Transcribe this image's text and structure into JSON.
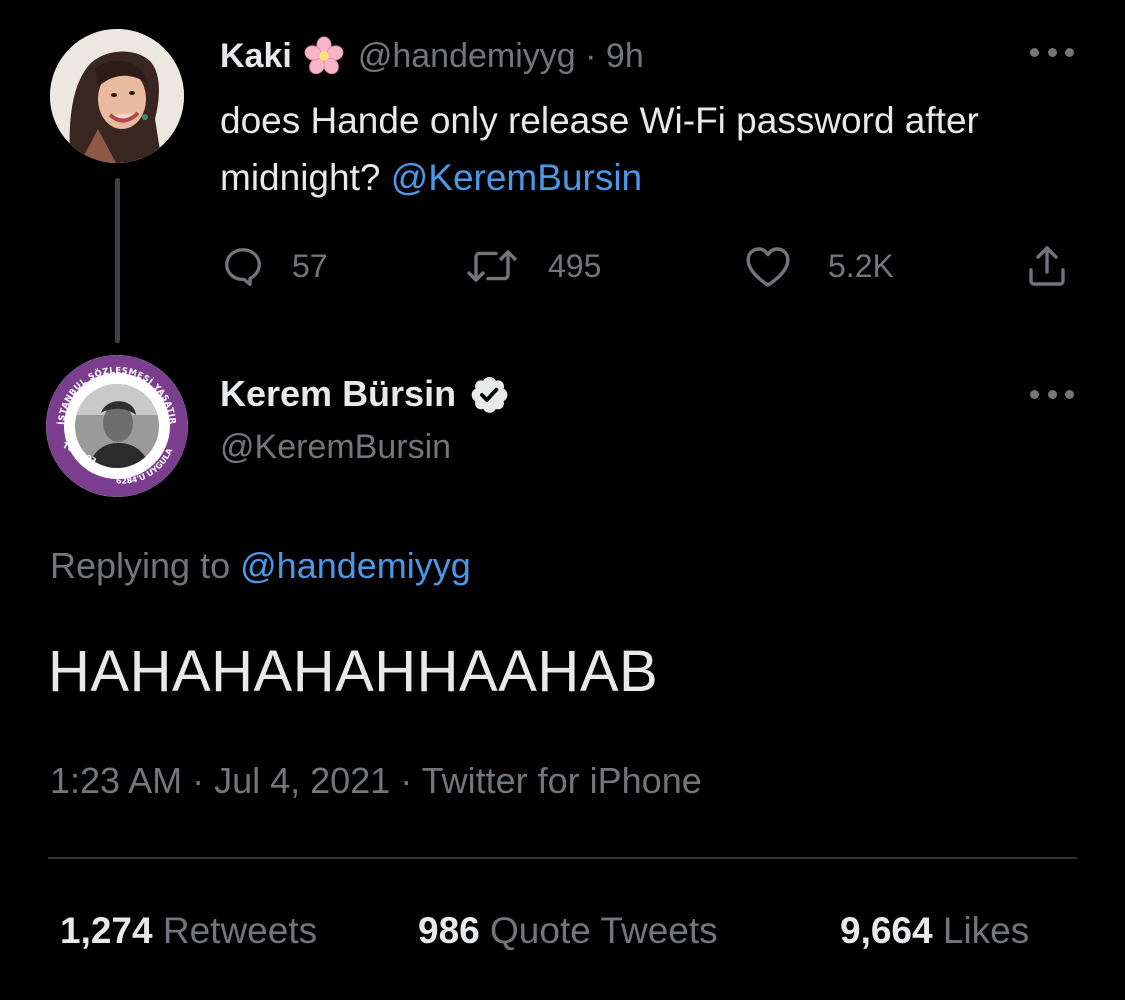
{
  "tweet": {
    "author_name": "Kaki",
    "author_handle": "@handemiyyg",
    "time_ago": "9h",
    "text": "does Hande only release Wi-Fi password after midnight?",
    "mention": "@KeremBursin",
    "reply_count": "57",
    "retweet_count": "495",
    "like_count": "5.2K",
    "name_emoji": "cherry-blossom-icon"
  },
  "reply": {
    "author_name": "Kerem Bürsin",
    "author_handle": "@KeremBursin",
    "verified": true,
    "replying_to_label": "Replying to",
    "replying_to_handle": "@handemiyyg",
    "text": "HAHAHAHAHHAAHAB",
    "time": "1:23 AM",
    "date": "Jul 4, 2021",
    "source": "Twitter for iPhone",
    "badge_text_top": "İSTANBUL SÖZLEŞMESİ YAŞATIR",
    "badge_text_left": "TCK-103",
    "badge_text_bottom": "6284'Ü UYGULA"
  },
  "stats": {
    "retweets_count": "1,274",
    "retweets_label": "Retweets",
    "quotes_count": "986",
    "quotes_label": "Quote Tweets",
    "likes_count": "9,664",
    "likes_label": "Likes"
  },
  "colors": {
    "background": "#000000",
    "text": "#E7E9EA",
    "muted": "#71767B",
    "link": "#4A99E9",
    "badge_purple": "#7B3E8F"
  }
}
